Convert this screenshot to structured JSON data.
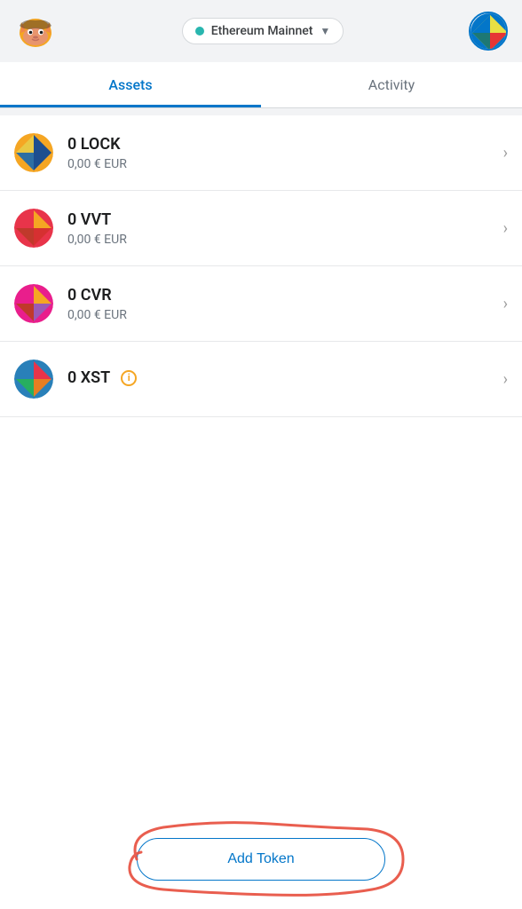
{
  "header": {
    "network": {
      "name": "Ethereum Mainnet",
      "dot_color": "#29b6af"
    }
  },
  "tabs": [
    {
      "id": "assets",
      "label": "Assets",
      "active": true
    },
    {
      "id": "activity",
      "label": "Activity",
      "active": false
    }
  ],
  "tokens": [
    {
      "id": "lock",
      "symbol": "LOCK",
      "amount": "0 LOCK",
      "value": "0,00 € EUR",
      "has_info": false
    },
    {
      "id": "vvt",
      "symbol": "VVT",
      "amount": "0 VVT",
      "value": "0,00 € EUR",
      "has_info": false
    },
    {
      "id": "cvr",
      "symbol": "CVR",
      "amount": "0 CVR",
      "value": "0,00 € EUR",
      "has_info": false
    },
    {
      "id": "xst",
      "symbol": "XST",
      "amount": "0 XST",
      "value": "",
      "has_info": true
    }
  ],
  "add_token_button": {
    "label": "Add Token"
  }
}
